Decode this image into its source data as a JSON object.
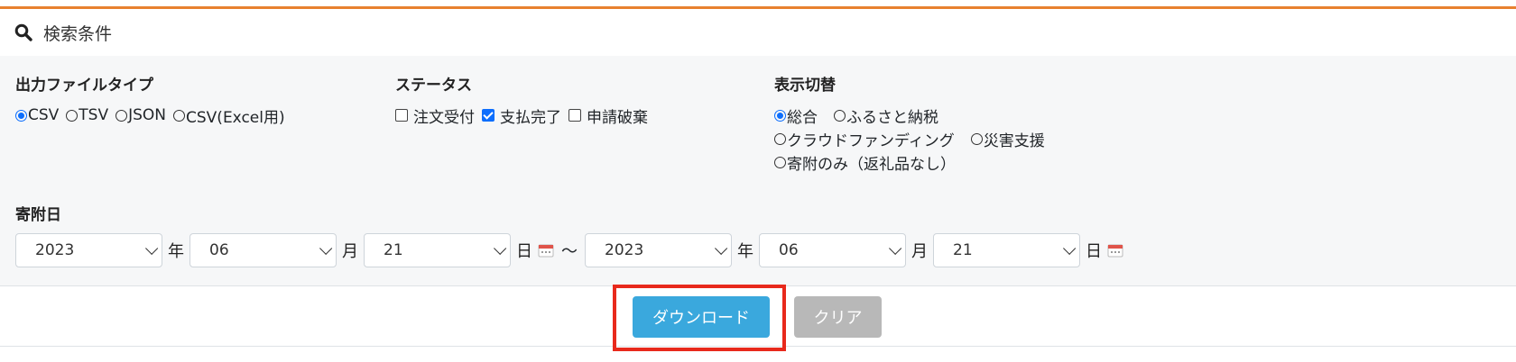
{
  "header": {
    "title": "検索条件",
    "icon": "search-icon"
  },
  "output_type": {
    "title": "出力ファイルタイプ",
    "options": [
      "CSV",
      "TSV",
      "JSON",
      "CSV(Excel用)"
    ],
    "selected": "CSV"
  },
  "status": {
    "title": "ステータス",
    "options": [
      {
        "label": "注文受付",
        "checked": false
      },
      {
        "label": "支払完了",
        "checked": true
      },
      {
        "label": "申請破棄",
        "checked": false
      }
    ]
  },
  "display": {
    "title": "表示切替",
    "options": [
      "総合",
      "ふるさと納税",
      "クラウドファンディング",
      "災害支援",
      "寄附のみ（返礼品なし）"
    ],
    "selected": "総合"
  },
  "donation_date": {
    "title": "寄附日",
    "from": {
      "year": "2023",
      "month": "06",
      "day": "21"
    },
    "to": {
      "year": "2023",
      "month": "06",
      "day": "21"
    },
    "unit_year": "年",
    "unit_month": "月",
    "unit_day": "日",
    "separator": "～"
  },
  "buttons": {
    "download": "ダウンロード",
    "clear": "クリア"
  },
  "colors": {
    "accent_top": "#e8812f",
    "primary": "#3aa8dd",
    "disabled": "#b8b8b8",
    "highlight": "#e8291c",
    "check": "#0d6efd"
  }
}
